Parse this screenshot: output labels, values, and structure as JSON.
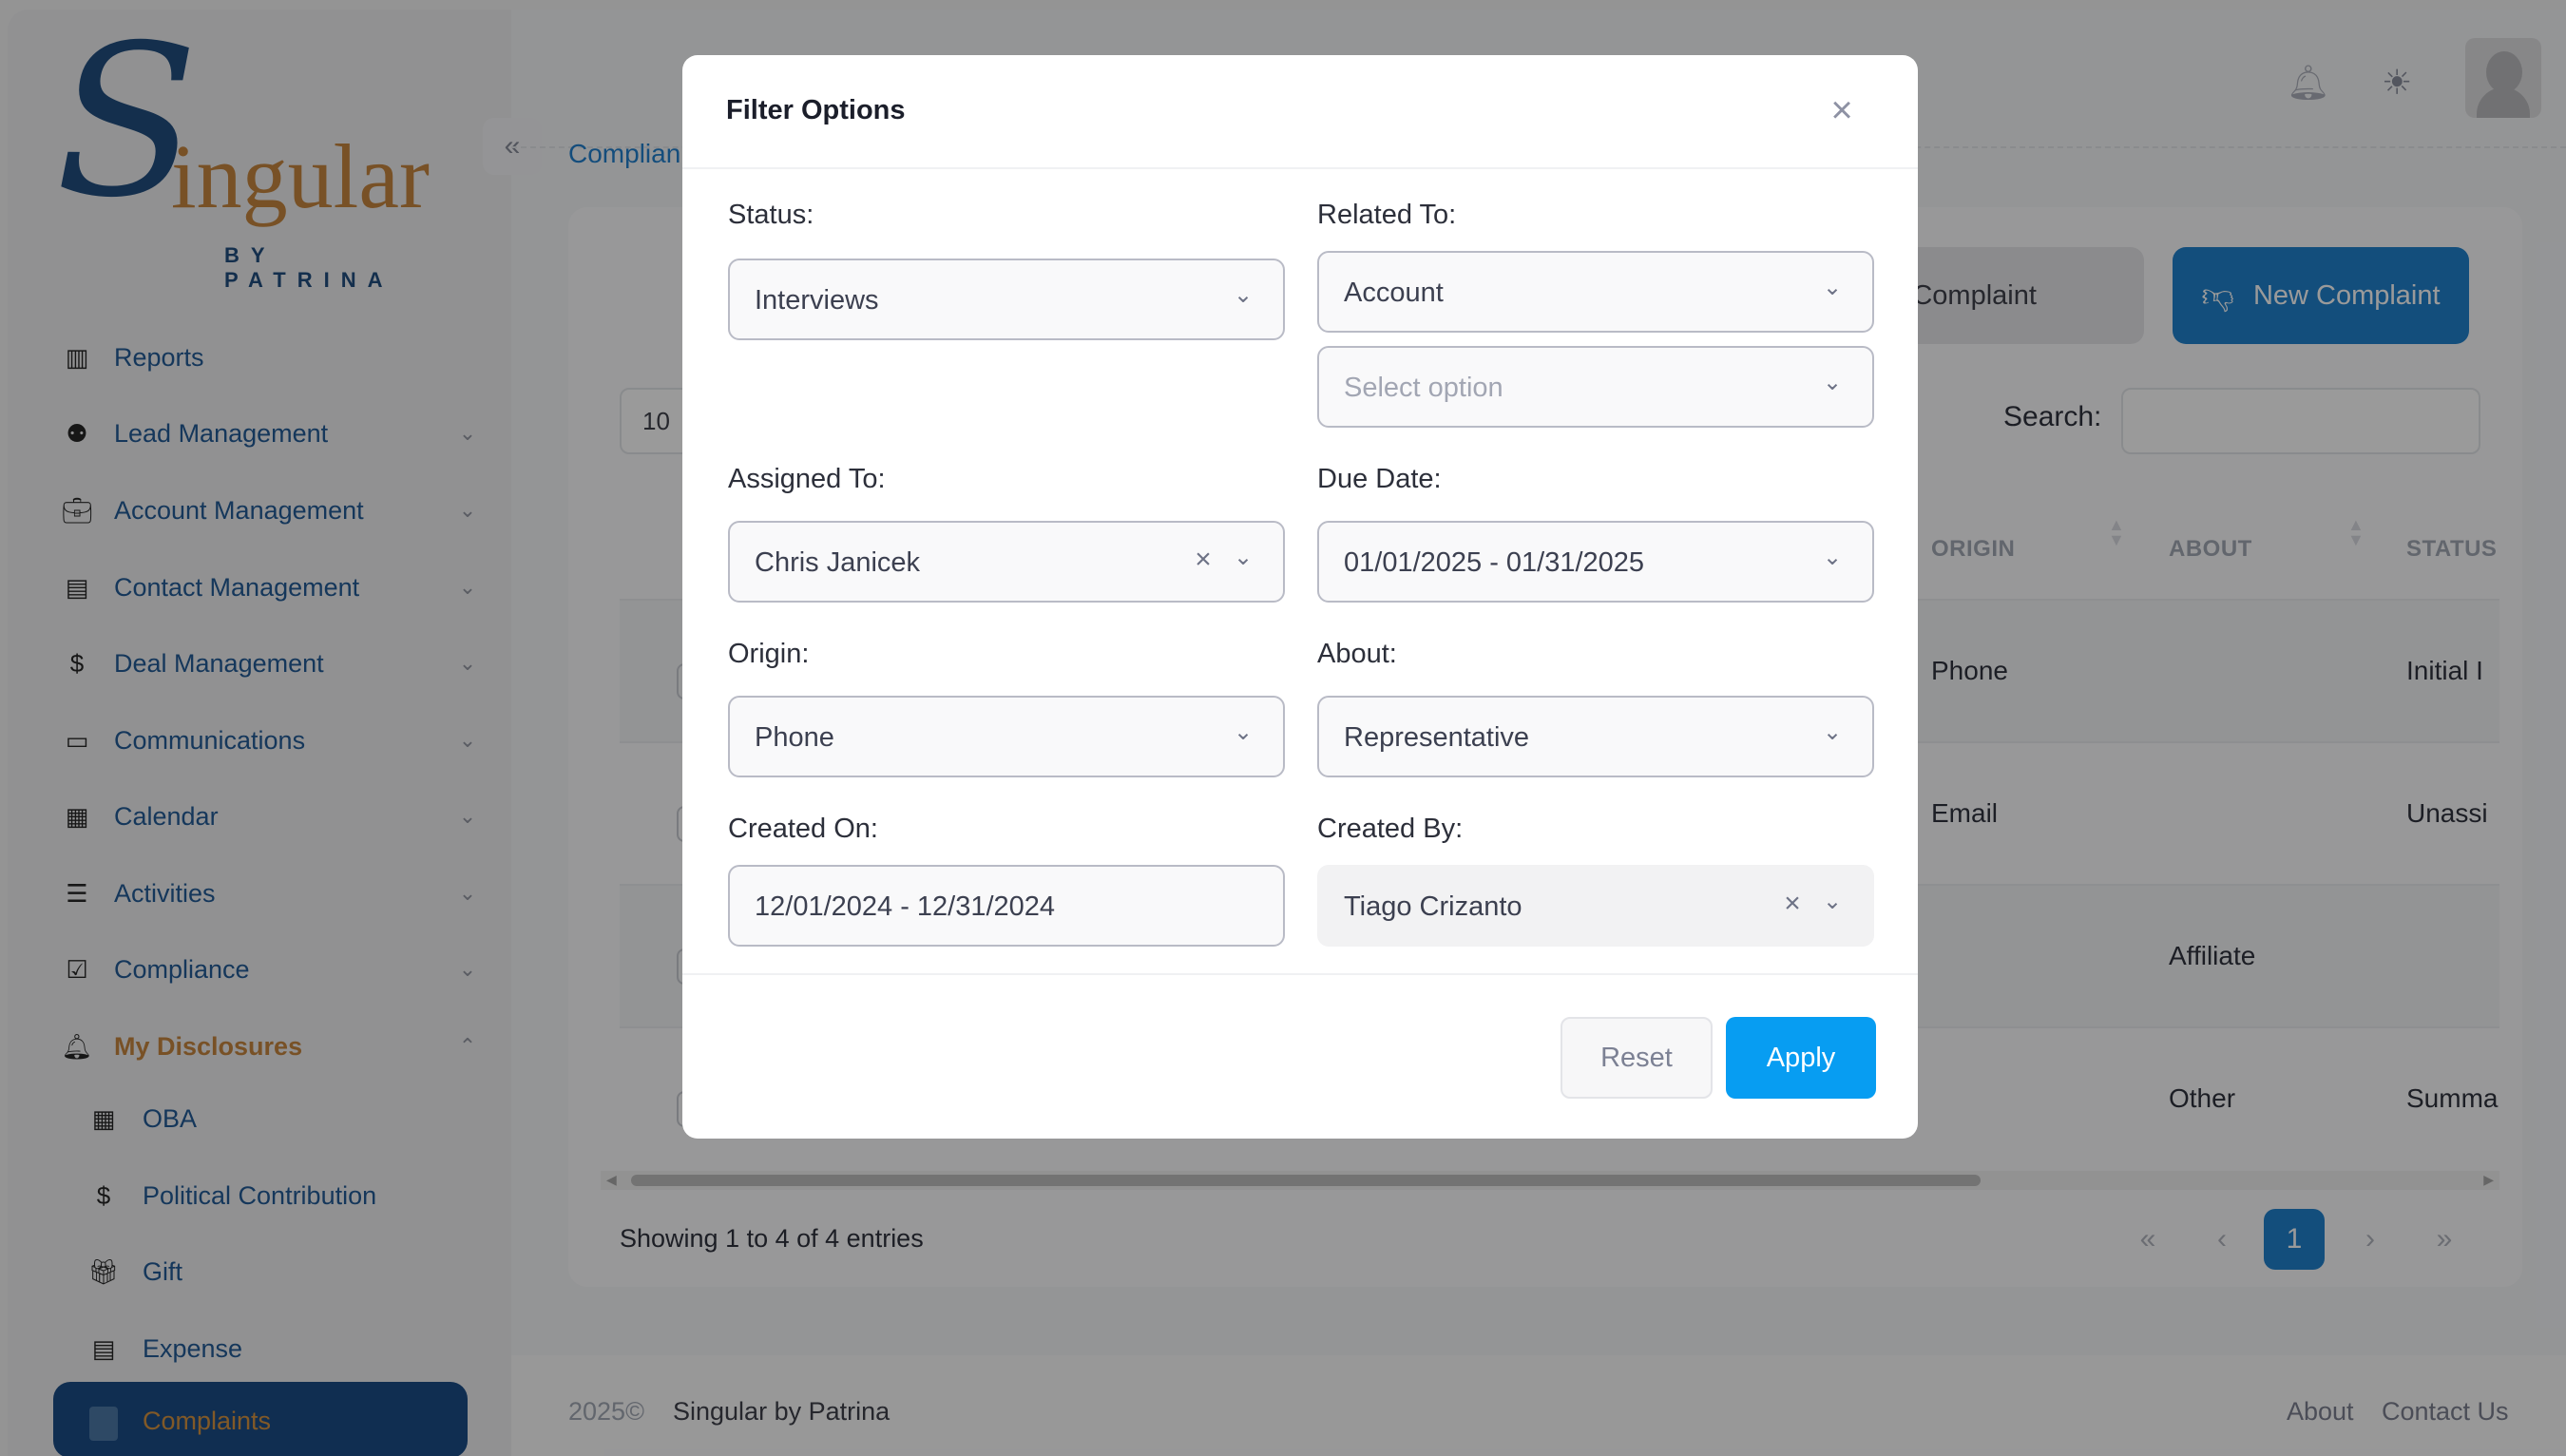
{
  "brand": {
    "logo_initial": "S",
    "logo_rest": "ingular",
    "logo_tagline": "BY PATRINA"
  },
  "sidebar": {
    "items": [
      {
        "label": "Reports",
        "icon": "reports-icon",
        "has_chevron": false
      },
      {
        "label": "Lead Management",
        "icon": "leads-icon",
        "has_chevron": true
      },
      {
        "label": "Account Management",
        "icon": "briefcase-icon",
        "has_chevron": true
      },
      {
        "label": "Contact Management",
        "icon": "contact-card-icon",
        "has_chevron": true
      },
      {
        "label": "Deal Management",
        "icon": "dollar-icon",
        "has_chevron": true
      },
      {
        "label": "Communications",
        "icon": "chat-icon",
        "has_chevron": true
      },
      {
        "label": "Calendar",
        "icon": "calendar-icon",
        "has_chevron": true
      },
      {
        "label": "Activities",
        "icon": "checklist-icon",
        "has_chevron": true
      },
      {
        "label": "Compliance",
        "icon": "check-icon",
        "has_chevron": true
      },
      {
        "label": "My Disclosures",
        "icon": "disclosures-icon",
        "has_chevron": true,
        "expanded": true,
        "active": true
      }
    ],
    "sub_items": [
      {
        "label": "OBA",
        "icon": "building-alert-icon"
      },
      {
        "label": "Political Contribution",
        "icon": "donation-icon"
      },
      {
        "label": "Gift",
        "icon": "gift-icon"
      },
      {
        "label": "Expense",
        "icon": "receipt-icon"
      },
      {
        "label": "Complaints",
        "icon": "complaints-icon",
        "active": true
      }
    ]
  },
  "header": {
    "breadcrumb": "Complian",
    "collapse_icon": "double-chevron-left-icon"
  },
  "toolbar": {
    "assign_label": "sign Complaint",
    "new_label": "New Complaint",
    "search_label": "Search:",
    "search_value": "",
    "page_length": "10"
  },
  "table": {
    "columns": [
      "ORIGIN",
      "ABOUT",
      "STATUS"
    ],
    "rows": [
      {
        "origin": "Phone",
        "about": "",
        "status": "Initial I"
      },
      {
        "origin": "Email",
        "about": "",
        "status": "Unassi"
      },
      {
        "origin": "",
        "about": "Affiliate",
        "status": ""
      },
      {
        "origin": "",
        "about": "Other",
        "status": "Summa"
      }
    ],
    "showing": "Showing 1 to 4 of 4 entries"
  },
  "pagination": {
    "first": "«",
    "prev": "‹",
    "current": "1",
    "next": "›",
    "last": "»"
  },
  "footer": {
    "copy": "2025©",
    "brand": "Singular by Patrina",
    "about": "About",
    "contact": "Contact Us"
  },
  "modal": {
    "title": "Filter Options",
    "fields": {
      "status": {
        "label": "Status:",
        "value": "Interviews"
      },
      "related_to": {
        "label": "Related To:",
        "value": "Account",
        "secondary_placeholder": "Select option"
      },
      "assigned_to": {
        "label": "Assigned To:",
        "value": "Chris Janicek",
        "clearable": true
      },
      "due_date": {
        "label": "Due Date:",
        "value": "01/01/2025 - 01/31/2025"
      },
      "origin": {
        "label": "Origin:",
        "value": "Phone"
      },
      "about": {
        "label": "About:",
        "value": "Representative"
      },
      "created_on": {
        "label": "Created On:",
        "value": "12/01/2024 - 12/31/2024"
      },
      "created_by": {
        "label": "Created By:",
        "value": "Tiago Crizanto",
        "clearable": true
      }
    },
    "reset_label": "Reset",
    "apply_label": "Apply"
  },
  "colors": {
    "primary": "#0a75c9",
    "apply": "#079df2",
    "accent": "#c27a2c",
    "nav_text": "#0d4c8c",
    "active_bg": "#053b7a"
  }
}
